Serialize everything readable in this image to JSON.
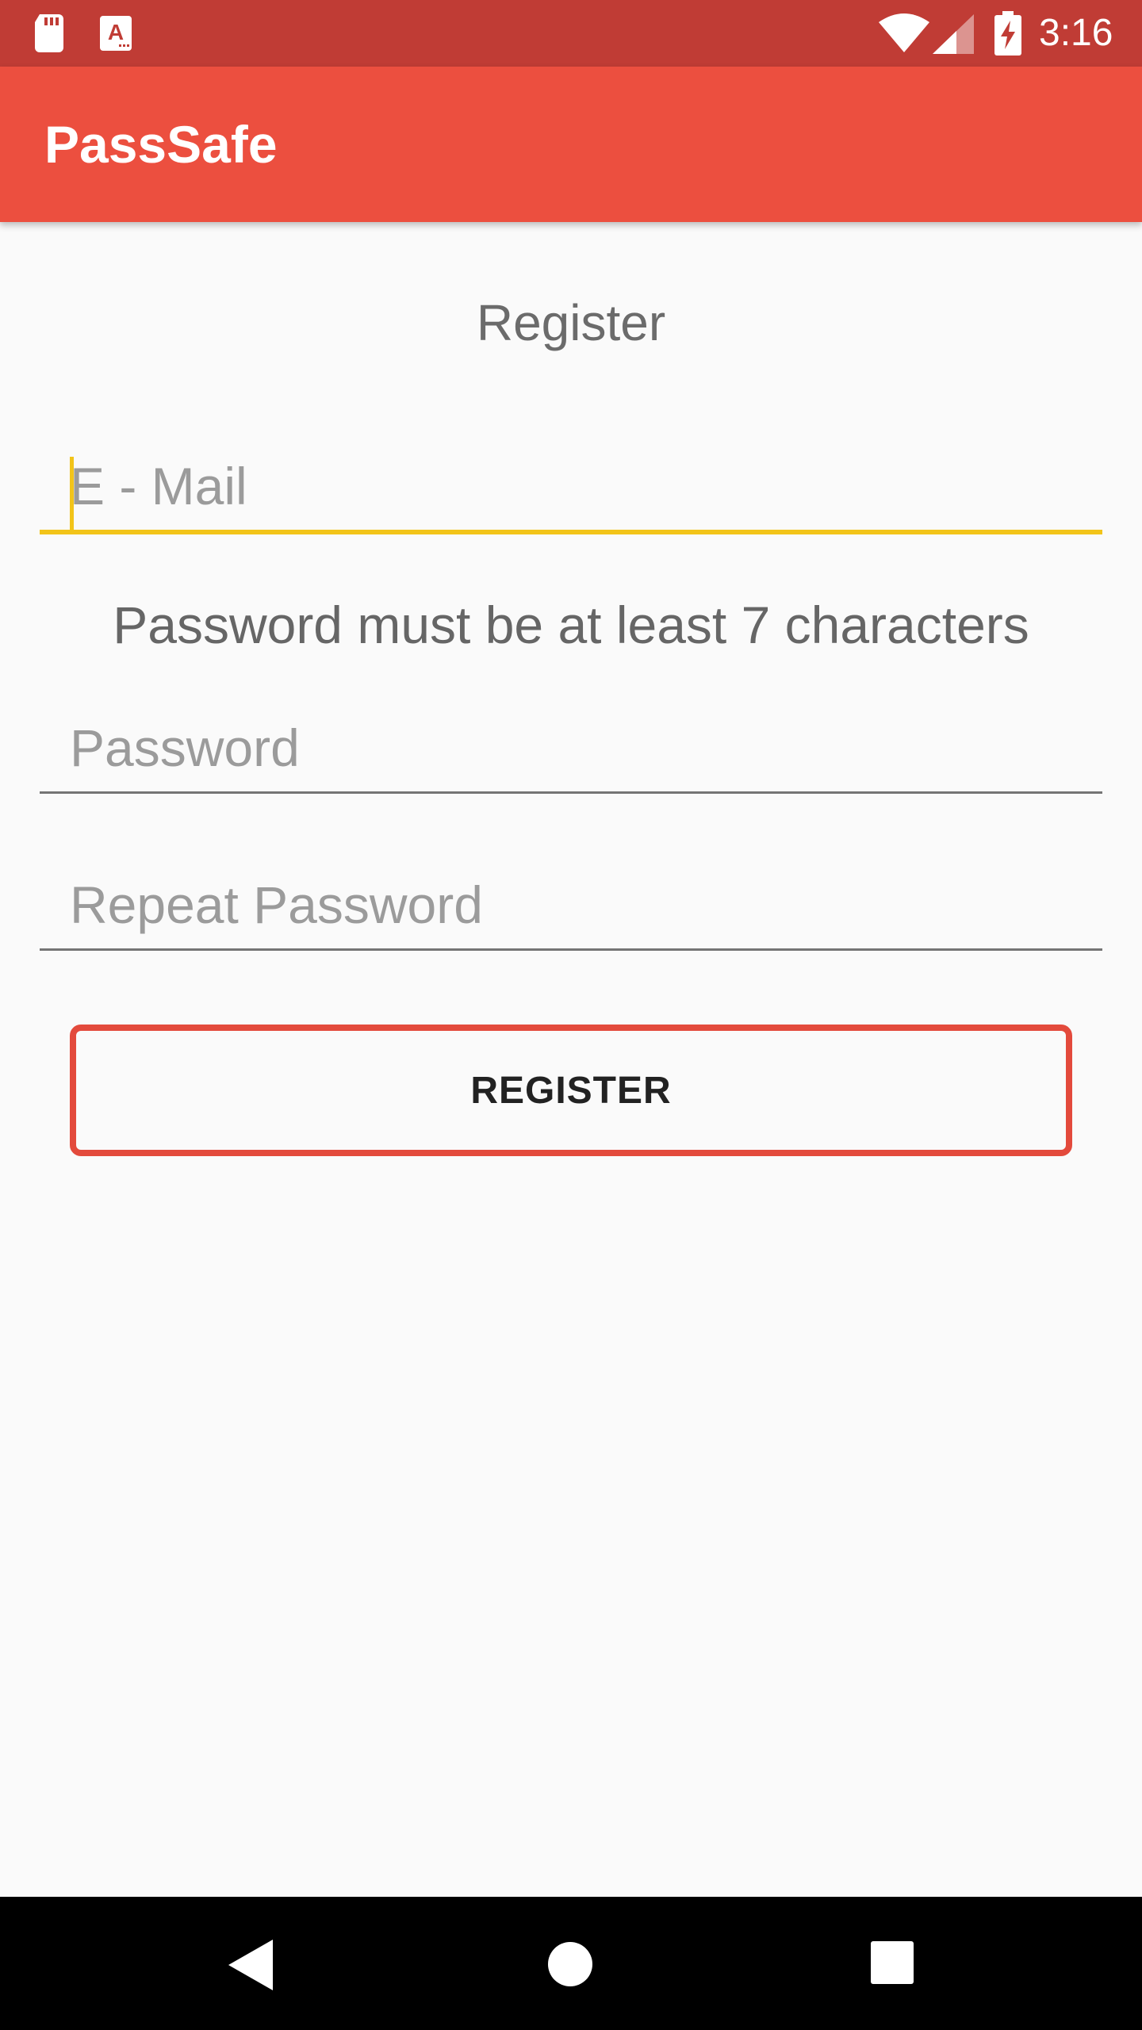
{
  "status_bar": {
    "time": "3:16",
    "icons": [
      "sd-card-icon",
      "app-notification-icon",
      "wifi-icon",
      "cell-signal-icon",
      "battery-charging-icon"
    ]
  },
  "app_bar": {
    "title": "PassSafe"
  },
  "form": {
    "title": "Register",
    "email": {
      "placeholder": "E - Mail",
      "value": ""
    },
    "password_hint": "Password must be at least 7 characters",
    "password": {
      "placeholder": "Password",
      "value": ""
    },
    "repeat_password": {
      "placeholder": "Repeat Password",
      "value": ""
    },
    "register_label": "REGISTER"
  },
  "nav_bar": {
    "icons": [
      "back-icon",
      "home-icon",
      "recents-icon"
    ]
  },
  "colors": {
    "status_bar": "#c03c35",
    "app_bar": "#ec4f3f",
    "focus_accent": "#f2c419",
    "button_border": "#e34a3c"
  }
}
